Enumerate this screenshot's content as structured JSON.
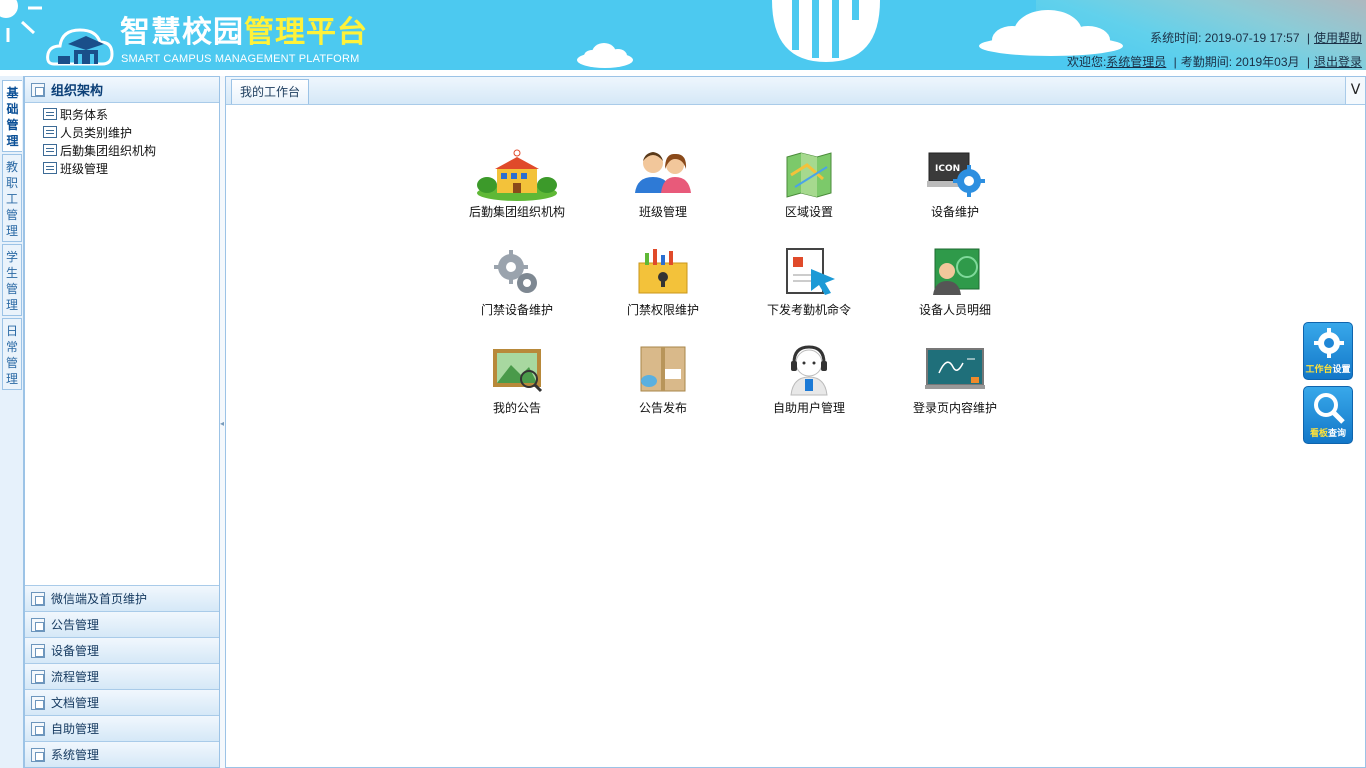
{
  "header": {
    "title_part1": "智慧校园",
    "title_part2": "管理平台",
    "subtitle": "SMART CAMPUS MANAGEMENT PLATFORM",
    "system_time_label": "系统时间:",
    "system_time": "2019-07-19 17:57",
    "help_link": "使用帮助",
    "welcome_label": "欢迎您:",
    "user_link": "系统管理员",
    "attendance_label": "考勤期间:",
    "attendance_period": "2019年03月",
    "logout_link": "退出登录",
    "sep": "|"
  },
  "vtabs": [
    {
      "label": "基础管理",
      "active": true
    },
    {
      "label": "教职工管理",
      "active": false
    },
    {
      "label": "学生管理",
      "active": false
    },
    {
      "label": "日常管理",
      "active": false
    }
  ],
  "sidebar": {
    "panel_title": "组织架构",
    "tree": [
      "职务体系",
      "人员类别维护",
      "后勤集团组织机构",
      "班级管理"
    ],
    "accordion": [
      "微信端及首页维护",
      "公告管理",
      "设备管理",
      "流程管理",
      "文档管理",
      "自助管理",
      "系统管理"
    ]
  },
  "main": {
    "tab_label": "我的工作台",
    "tab_tool": "V",
    "items": [
      {
        "label": "后勤集团组织机构",
        "icon": "campus-building-icon"
      },
      {
        "label": "班级管理",
        "icon": "people-icon"
      },
      {
        "label": "区域设置",
        "icon": "map-icon"
      },
      {
        "label": "设备维护",
        "icon": "monitor-gear-icon"
      },
      {
        "label": "门禁设备维护",
        "icon": "gears-icon"
      },
      {
        "label": "门禁权限维护",
        "icon": "lock-box-icon"
      },
      {
        "label": "下发考勤机命令",
        "icon": "cursor-board-icon"
      },
      {
        "label": "设备人员明细",
        "icon": "person-panel-icon"
      },
      {
        "label": "我的公告",
        "icon": "picture-search-icon"
      },
      {
        "label": "公告发布",
        "icon": "package-icon"
      },
      {
        "label": "自助用户管理",
        "icon": "headset-user-icon"
      },
      {
        "label": "登录页内容维护",
        "icon": "chalkboard-icon"
      }
    ]
  },
  "floating": {
    "workbench_settings_a": "工作台",
    "workbench_settings_b": "设置",
    "dashboard_query_a": "看板",
    "dashboard_query_b": "查询"
  }
}
